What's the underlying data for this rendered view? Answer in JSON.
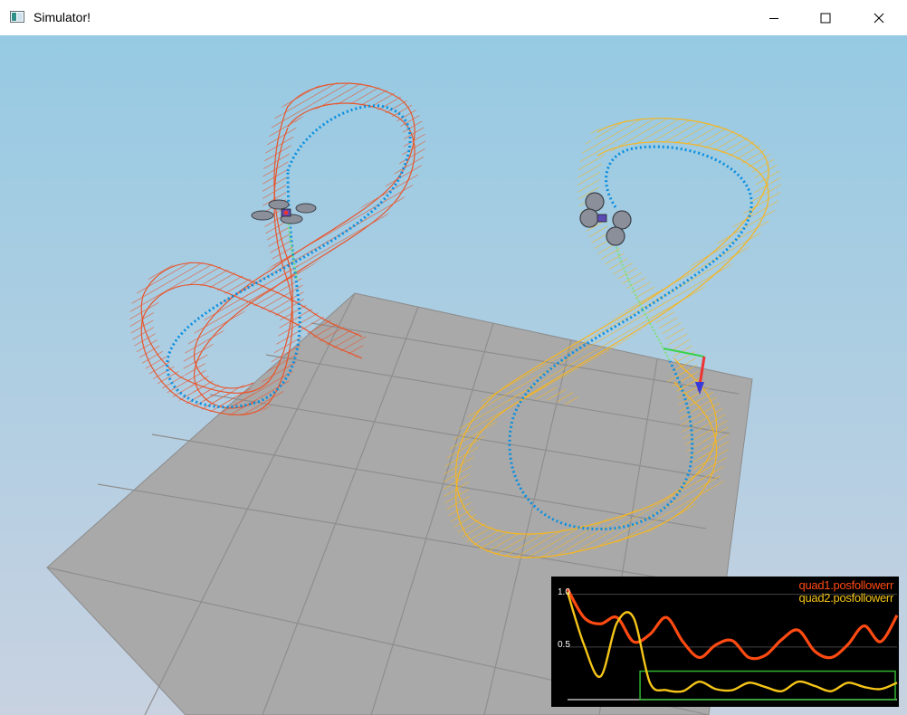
{
  "window": {
    "title": "Simulator!",
    "controls": {
      "minimize": "minimize",
      "maximize": "maximize",
      "close": "close"
    }
  },
  "scene": {
    "quad1_color": "#e8552b",
    "quad2_color": "#f5b521",
    "path_color": "#0a8fe0",
    "floor_color": "#a8a8a8",
    "sky_top": "#97cbe3",
    "sky_bottom": "#c7d3e1"
  },
  "plot": {
    "background": "#000000",
    "box_color": "#2fb52f",
    "y_ticks": [
      "1.0",
      "0.5"
    ],
    "legend": [
      {
        "label": "quad1.posfollowerr",
        "color": "#ff4a12"
      },
      {
        "label": "quad2.posfollowerr",
        "color": "#f5c518"
      }
    ]
  },
  "chart_data": {
    "type": "line",
    "title": "",
    "xlabel": "",
    "ylabel": "",
    "ylim": [
      0,
      1.1
    ],
    "grid": true,
    "legend_position": "top-right",
    "x": [
      0,
      1,
      2,
      3,
      4,
      5,
      6,
      7,
      8,
      9,
      10,
      11,
      12,
      13,
      14,
      15,
      16,
      17,
      18,
      19,
      20
    ],
    "series": [
      {
        "name": "quad1.posfollowerr",
        "values": [
          1.05,
          0.78,
          0.72,
          0.78,
          0.55,
          0.62,
          0.78,
          0.55,
          0.4,
          0.52,
          0.56,
          0.4,
          0.42,
          0.57,
          0.66,
          0.46,
          0.4,
          0.52,
          0.7,
          0.55,
          0.8
        ]
      },
      {
        "name": "quad2.posfollowerr",
        "values": [
          1.02,
          0.52,
          0.22,
          0.73,
          0.78,
          0.16,
          0.09,
          0.08,
          0.17,
          0.1,
          0.09,
          0.16,
          0.12,
          0.08,
          0.17,
          0.13,
          0.08,
          0.16,
          0.12,
          0.1,
          0.16
        ]
      }
    ]
  }
}
